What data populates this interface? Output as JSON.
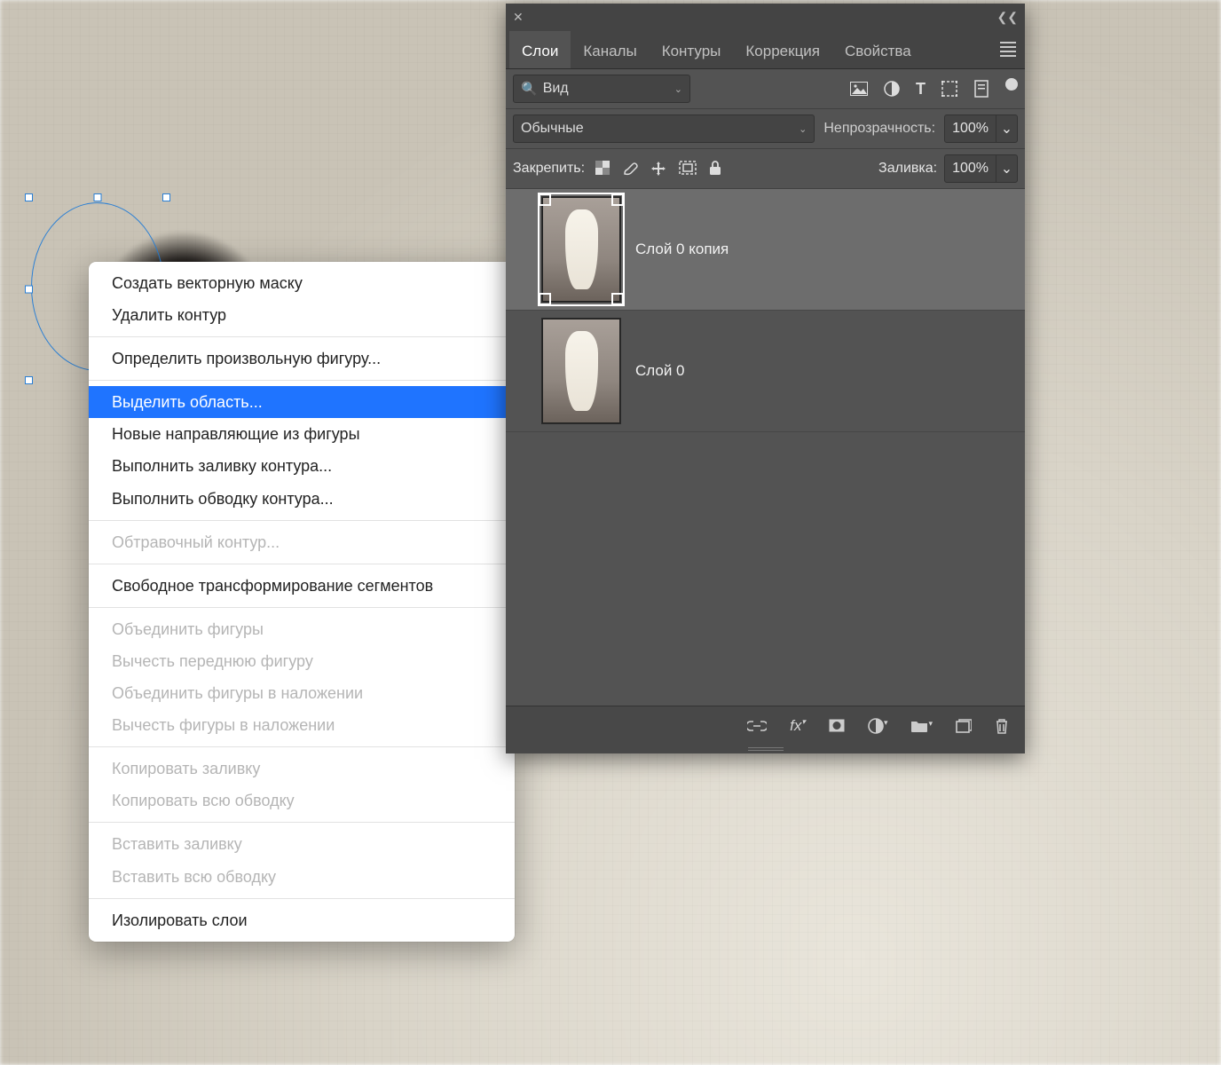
{
  "contextMenu": {
    "items": [
      {
        "label": "Создать векторную маску",
        "enabled": true
      },
      {
        "label": "Удалить контур",
        "enabled": true
      },
      {
        "sep": true
      },
      {
        "label": "Определить произвольную фигуру...",
        "enabled": true
      },
      {
        "sep": true
      },
      {
        "label": "Выделить область...",
        "enabled": true,
        "highlighted": true
      },
      {
        "label": "Новые направляющие из фигуры",
        "enabled": true
      },
      {
        "label": "Выполнить заливку контура...",
        "enabled": true
      },
      {
        "label": "Выполнить обводку контура...",
        "enabled": true
      },
      {
        "sep": true
      },
      {
        "label": "Обтравочный контур...",
        "enabled": false
      },
      {
        "sep": true
      },
      {
        "label": "Свободное трансформирование сегментов",
        "enabled": true
      },
      {
        "sep": true
      },
      {
        "label": "Объединить фигуры",
        "enabled": false
      },
      {
        "label": "Вычесть переднюю фигуру",
        "enabled": false
      },
      {
        "label": "Объединить фигуры в наложении",
        "enabled": false
      },
      {
        "label": "Вычесть фигуры в наложении",
        "enabled": false
      },
      {
        "sep": true
      },
      {
        "label": "Копировать заливку",
        "enabled": false
      },
      {
        "label": "Копировать всю обводку",
        "enabled": false
      },
      {
        "sep": true
      },
      {
        "label": "Вставить заливку",
        "enabled": false
      },
      {
        "label": "Вставить всю обводку",
        "enabled": false
      },
      {
        "sep": true
      },
      {
        "label": "Изолировать слои",
        "enabled": true
      }
    ]
  },
  "panel": {
    "tabs": [
      "Слои",
      "Каналы",
      "Контуры",
      "Коррекция",
      "Свойства"
    ],
    "activeTab": 0,
    "search": {
      "label": "Вид"
    },
    "filterIcons": [
      "image",
      "adjust",
      "text",
      "shape",
      "smart"
    ],
    "blendMode": "Обычные",
    "opacityLabel": "Непрозрачность:",
    "opacityValue": "100%",
    "lockLabel": "Закрепить:",
    "fillLabel": "Заливка:",
    "fillValue": "100%",
    "layers": [
      {
        "name": "Слой 0 копия",
        "selected": true
      },
      {
        "name": "Слой 0",
        "selected": false
      }
    ],
    "footerIcons": [
      "link",
      "fx",
      "mask",
      "adjustment",
      "group",
      "new",
      "delete"
    ]
  }
}
